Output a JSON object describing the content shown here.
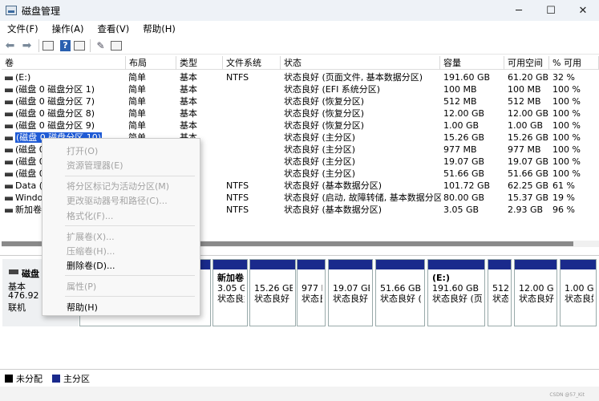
{
  "window": {
    "title": "磁盘管理",
    "controls": {
      "minimize": "─",
      "maximize": "☐",
      "close": "✕"
    }
  },
  "menu": [
    "文件(F)",
    "操作(A)",
    "查看(V)",
    "帮助(H)"
  ],
  "toolbar_icons": [
    "back-icon",
    "forward-icon",
    "properties-icon",
    "help-icon",
    "details-icon",
    "refresh-icon",
    "disk-list-icon"
  ],
  "table": {
    "columns": [
      "卷",
      "布局",
      "类型",
      "文件系统",
      "状态",
      "容量",
      "可用空间",
      "% 可用"
    ],
    "rows": [
      [
        "(E:)",
        "简单",
        "基本",
        "NTFS",
        "状态良好 (页面文件, 基本数据分区)",
        "191.60 GB",
        "61.20 GB",
        "32 %"
      ],
      [
        "(磁盘 0 磁盘分区 1)",
        "简单",
        "基本",
        "",
        "状态良好 (EFI 系统分区)",
        "100 MB",
        "100 MB",
        "100 %"
      ],
      [
        "(磁盘 0 磁盘分区 7)",
        "简单",
        "基本",
        "",
        "状态良好 (恢复分区)",
        "512 MB",
        "512 MB",
        "100 %"
      ],
      [
        "(磁盘 0 磁盘分区 8)",
        "简单",
        "基本",
        "",
        "状态良好 (恢复分区)",
        "12.00 GB",
        "12.00 GB",
        "100 %"
      ],
      [
        "(磁盘 0 磁盘分区 9)",
        "简单",
        "基本",
        "",
        "状态良好 (恢复分区)",
        "1.00 GB",
        "1.00 GB",
        "100 %"
      ],
      [
        "(磁盘 0 磁盘分区 10)",
        "简单",
        "基本",
        "",
        "状态良好 (主分区)",
        "15.26 GB",
        "15.26 GB",
        "100 %"
      ],
      [
        "(磁盘 0",
        "",
        "",
        "",
        "状态良好 (主分区)",
        "977 MB",
        "977 MB",
        "100 %"
      ],
      [
        "(磁盘 0",
        "",
        "",
        "",
        "状态良好 (主分区)",
        "19.07 GB",
        "19.07 GB",
        "100 %"
      ],
      [
        "(磁盘 0",
        "",
        "",
        "",
        "状态良好 (主分区)",
        "51.66 GB",
        "51.66 GB",
        "100 %"
      ],
      [
        "Data (D",
        "",
        "",
        "NTFS",
        "状态良好 (基本数据分区)",
        "101.72 GB",
        "62.25 GB",
        "61 %"
      ],
      [
        "Windo",
        "",
        "",
        "NTFS",
        "状态良好 (启动, 故障转储, 基本数据分区)",
        "80.00 GB",
        "15.37 GB",
        "19 %"
      ],
      [
        "新加卷",
        "",
        "",
        "NTFS",
        "状态良好 (基本数据分区)",
        "3.05 GB",
        "2.93 GB",
        "96 %"
      ]
    ],
    "selected_row": 5
  },
  "context_menu": [
    {
      "label": "打开(O)",
      "enabled": false
    },
    {
      "label": "资源管理器(E)",
      "enabled": false
    },
    {
      "label": "将分区标记为活动分区(M)",
      "enabled": false
    },
    {
      "label": "更改驱动器号和路径(C)...",
      "enabled": false
    },
    {
      "label": "格式化(F)...",
      "enabled": false
    },
    {
      "label": "扩展卷(X)...",
      "enabled": false
    },
    {
      "label": "压缩卷(H)...",
      "enabled": false
    },
    {
      "label": "删除卷(D)...",
      "enabled": true
    },
    {
      "label": "属性(P)",
      "enabled": false
    },
    {
      "label": "帮助(H)",
      "enabled": true
    }
  ],
  "disk": {
    "name": "磁盘 0",
    "type": "基本",
    "size": "476.92 GB",
    "status": "联机"
  },
  "partitions": [
    {
      "title": "新加卷",
      "size": "3.05 GB",
      "status": "状态良好 ("
    },
    {
      "title": "",
      "size": "15.26 GB",
      "status": "状态良好 ("
    },
    {
      "title": "",
      "size": "977 M",
      "status": "状态良"
    },
    {
      "title": "",
      "size": "19.07 GB",
      "status": "状态良好 ("
    },
    {
      "title": "",
      "size": "51.66 GB",
      "status": "状态良好 ("
    },
    {
      "title": "(E:)",
      "size": "191.60 GB N",
      "status": "状态良好 (页面"
    },
    {
      "title": "",
      "size": "512 M",
      "status": "状态良"
    },
    {
      "title": "",
      "size": "12.00 GB",
      "status": "状态良好"
    },
    {
      "title": "",
      "size": "1.00 GB",
      "status": "状态良好"
    }
  ],
  "legend": [
    {
      "label": "未分配",
      "color": "#000000"
    },
    {
      "label": "主分区",
      "color": "#1a2a8c"
    }
  ],
  "watermark": "CSDN @57_Kit"
}
